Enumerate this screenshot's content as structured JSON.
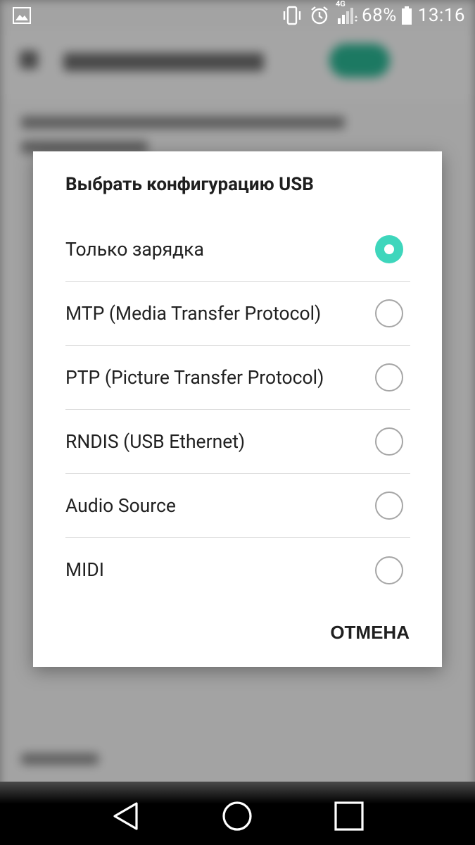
{
  "status_bar": {
    "signal_label": "4G",
    "battery": "68%",
    "time": "13:16"
  },
  "dialog": {
    "title": "Выбрать конфигурацию USB",
    "options": [
      {
        "label": "Только зарядка",
        "selected": true
      },
      {
        "label": "MTP (Media Transfer Protocol)",
        "selected": false
      },
      {
        "label": "PTP (Picture Transfer Protocol)",
        "selected": false
      },
      {
        "label": "RNDIS (USB Ethernet)",
        "selected": false
      },
      {
        "label": "Audio Source",
        "selected": false
      },
      {
        "label": "MIDI",
        "selected": false
      }
    ],
    "cancel_label": "ОТМЕНА"
  },
  "colors": {
    "accent": "#3ed6bc",
    "radio_unselected": "#a6a6a6"
  },
  "navigation": {
    "icons": [
      "back-icon",
      "home-icon",
      "recents-icon"
    ]
  }
}
